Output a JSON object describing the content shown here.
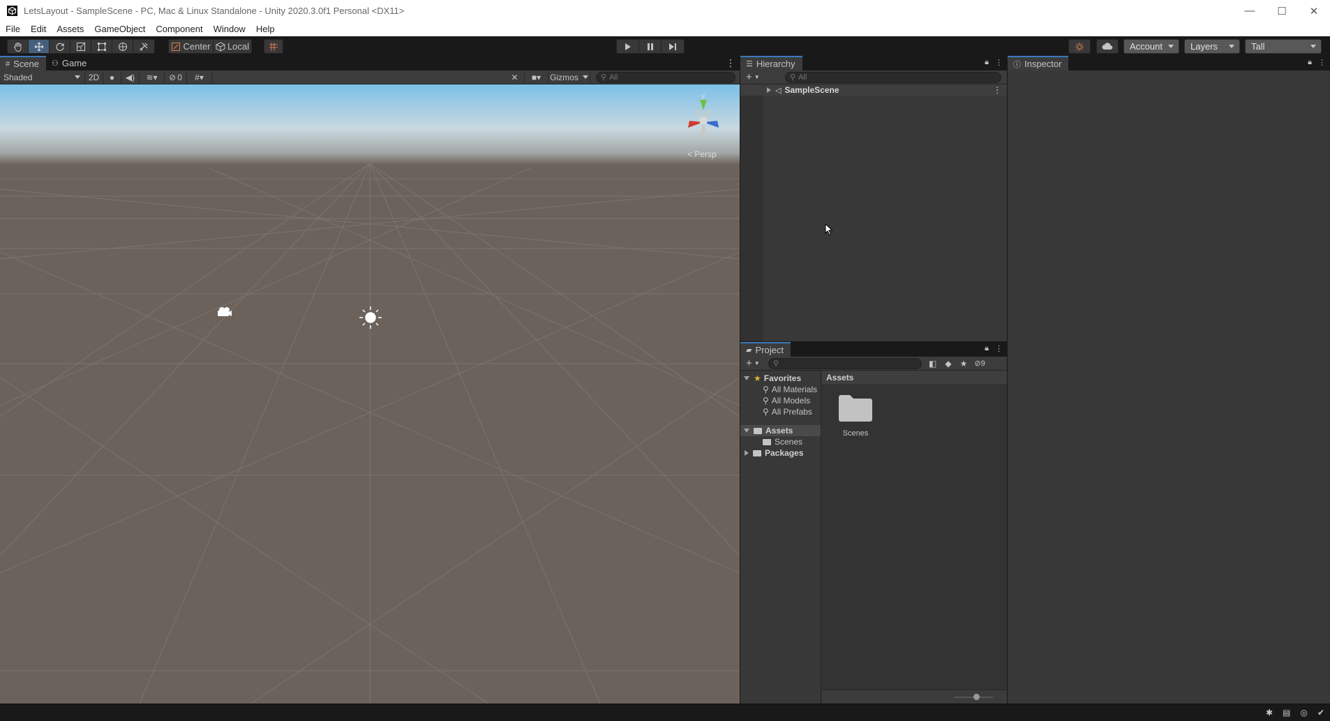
{
  "window": {
    "title": "LetsLayout - SampleScene - PC, Mac & Linux Standalone - Unity 2020.3.0f1 Personal <DX11>",
    "controls": [
      "—",
      "☐",
      "✕"
    ]
  },
  "menu": [
    "File",
    "Edit",
    "Assets",
    "GameObject",
    "Component",
    "Window",
    "Help"
  ],
  "toolbar": {
    "pivot_label": "Center",
    "space_label": "Local",
    "account_label": "Account",
    "layers_label": "Layers",
    "layout_label": "Tall"
  },
  "scene": {
    "tabs": [
      "Scene",
      "Game"
    ],
    "shading_mode": "Shaded",
    "mode_2d": "2D",
    "hidden_count": "0",
    "gizmos_label": "Gizmos",
    "search_placeholder": "All",
    "persp_label": "Persp",
    "gizmo_axis_y": "y",
    "viewport_colors": {
      "sky_top": "#7cc0e8",
      "sky_horizon": "#c8d8e0",
      "ground": "#6b625c",
      "grid": "#7d746d"
    }
  },
  "hierarchy": {
    "tab": "Hierarchy",
    "search_placeholder": "All",
    "scene_item": "SampleScene"
  },
  "project": {
    "tab": "Project",
    "hidden_count": "9",
    "favorites_label": "Favorites",
    "favorites": [
      "All Materials",
      "All Models",
      "All Prefabs"
    ],
    "assets_label": "Assets",
    "assets_children": [
      "Scenes"
    ],
    "packages_label": "Packages",
    "breadcrumb": "Assets",
    "items": [
      {
        "name": "Scenes",
        "icon": "folder-icon"
      }
    ]
  },
  "inspector": {
    "tab": "Inspector"
  }
}
